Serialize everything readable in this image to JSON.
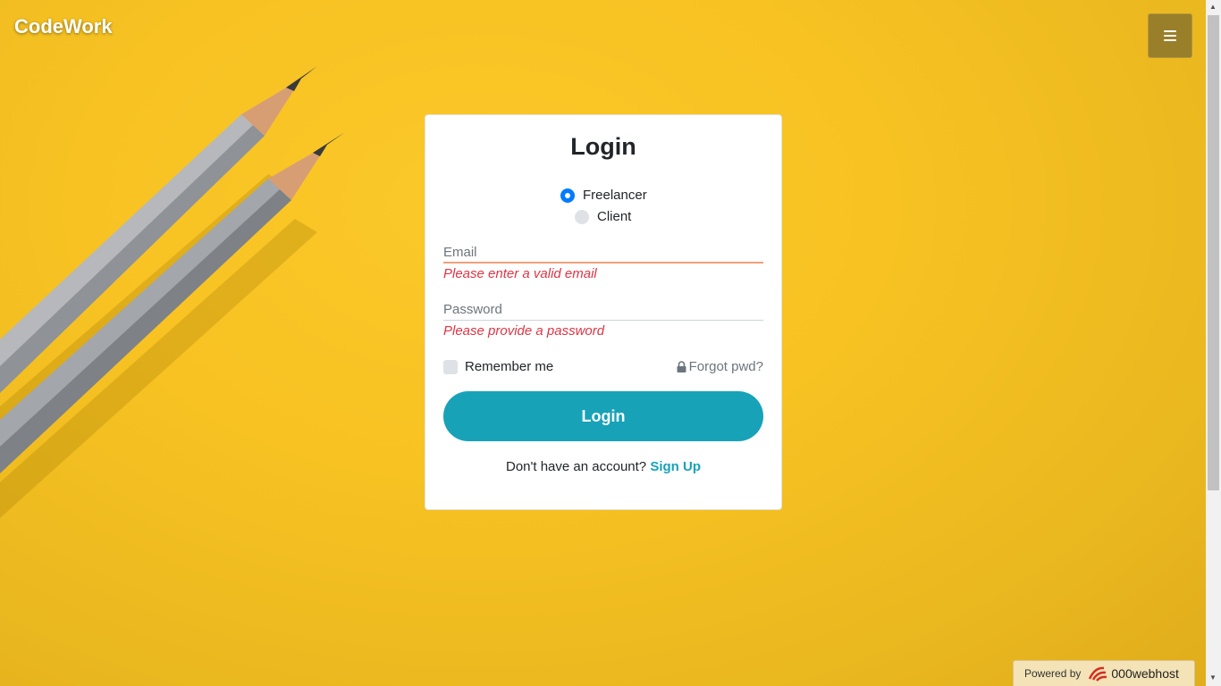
{
  "brand": {
    "name": "CodeWork"
  },
  "header": {
    "menu_icon": "hamburger-icon"
  },
  "login_form": {
    "title": "Login",
    "account_type": {
      "options": [
        "Freelancer",
        "Client"
      ],
      "selected": "Freelancer"
    },
    "email": {
      "placeholder": "Email",
      "value": "",
      "error": "Please enter a valid email"
    },
    "password": {
      "placeholder": "Password",
      "value": "",
      "error": "Please provide a password"
    },
    "remember_label": "Remember me",
    "forgot_label": "Forgot pwd?",
    "forgot_icon": "lock-icon",
    "submit_label": "Login",
    "signup_prompt": "Don't have an account?",
    "signup_link": "Sign Up"
  },
  "footer_badge": {
    "prefix": "Powered by",
    "host": "000webhost"
  },
  "colors": {
    "background": "#f7c222",
    "accent": "#17a2b8",
    "radio_selected": "#007bff",
    "error": "#dc3545",
    "menu_button": "#9a7f2b"
  }
}
